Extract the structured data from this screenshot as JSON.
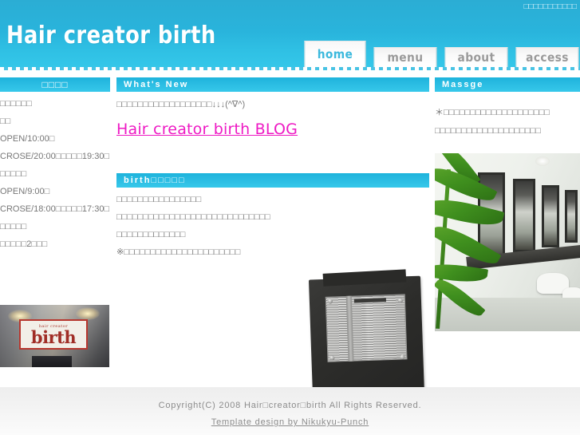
{
  "header": {
    "top_nav": "□□□□□□□□□□□",
    "site_title": "Hair creator birth",
    "tabs": [
      {
        "label": "home",
        "active": true
      },
      {
        "label": "menu",
        "active": false
      },
      {
        "label": "about",
        "active": false
      },
      {
        "label": "access",
        "active": false
      }
    ]
  },
  "sidebar_left": {
    "heading": "□□□□",
    "lines": [
      "□□□□□□",
      "□□",
      "OPEN/10:00□",
      "CROSE/20:00□□□□□19:30□",
      "□□□□□",
      "OPEN/9:00□",
      "CROSE/18:00□□□□□17:30□",
      "□□□□□",
      "□□□□□2□□□"
    ],
    "shop_photo": {
      "sign_small": "hair creator",
      "sign_big": "birth"
    }
  },
  "main": {
    "whats_new": {
      "heading": "What's New",
      "note": "□□□□□□□□□□□□□□□□□□↓↓↓(^∇^)",
      "blog_link": "Hair creator birth BLOG"
    },
    "birth_section": {
      "heading": "birth□□□□□",
      "bullets": [
        "□□□□□□□□□□□□□□□□",
        "□□□□□□□□□□□□□□□□□□□□□□□□□□□□□",
        "□□□□□□□□□□□□□",
        "※□□□□□□□□□□□□□□□□□□□□□□"
      ]
    }
  },
  "sidebar_right": {
    "heading": "Massge",
    "notes": [
      "＊□□□□□□□□□□□□□□□□□□□□",
      "□□□□□□□□□□□□□□□□□□□□"
    ]
  },
  "footer": {
    "copyright": "Copyright(C) 2008 Hair□creator□birth All Rights Reserved.",
    "template_credit": "Template design by Nikukyu-Punch"
  }
}
